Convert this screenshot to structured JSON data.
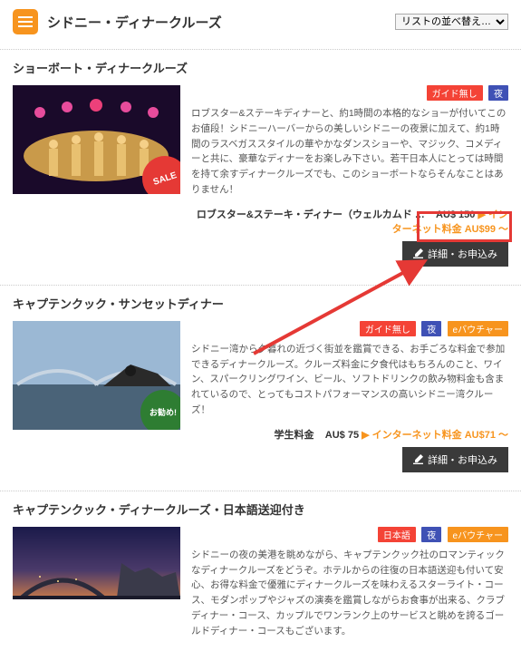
{
  "header": {
    "title": "シドニー・ディナークルーズ",
    "sort_label": "リストの並べ替え…"
  },
  "tags": {
    "guide_none": "ガイド無し",
    "night": "夜",
    "evoucher": "eバウチャー",
    "japanese": "日本語"
  },
  "common": {
    "detail_button": "詳細・お申込み",
    "internet_price_label": "インターネット料金"
  },
  "badges": {
    "sale": "SALE",
    "recommend": "お勧め!"
  },
  "tours": [
    {
      "title": "ショーボート・ディナークルーズ",
      "desc": "ロブスター&ステーキディナーと、約1時間の本格的なショーが付いてこのお値段！シドニーハーバーからの美しいシドニーの夜景に加えて、約1時間のラスベガススタイルの華やかなダンスショーや、マジック、コメディーと共に、豪華なディナーをお楽しみ下さい。若干日本人にとっては時間を持て余すディナークルーズでも、このショーボートならそんなことはありません！",
      "price_label": "ロブスター&ステーキ・ディナー（ウェルカムド …",
      "price_value": "AU$ 150",
      "net_price": "AU$99 ～"
    },
    {
      "title": "キャプテンクック・サンセットディナー",
      "desc": "シドニー湾から夕暮れの近づく街並を鑑賞できる、お手ごろな料金で参加できるディナークルーズ。クルーズ料金に夕食代はもちろんのこと、ワイン、スパークリングワイン、ビール、ソフトドリンクの飲み物料金も含まれているので、とってもコストパフォーマンスの高いシドニー湾クルーズ！",
      "price_label": "学生料金",
      "price_value": "AU$ 75",
      "net_price": "AU$71 ～"
    },
    {
      "title": "キャプテンクック・ディナークルーズ・日本語送迎付き",
      "desc": "シドニーの夜の美港を眺めながら、キャプテンクック社のロマンティックなディナークルーズをどうぞ。ホテルからの往復の日本語送迎も付いて安心、お得な料金で優雅にディナークルーズを味わえるスターライト・コース、モダンポップやジャズの演奏を鑑賞しながらお食事が出来る、クラブディナー・コース、カップルでワンランク上のサービスと眺めを誇るゴールドディナー・コースもございます。"
    }
  ]
}
